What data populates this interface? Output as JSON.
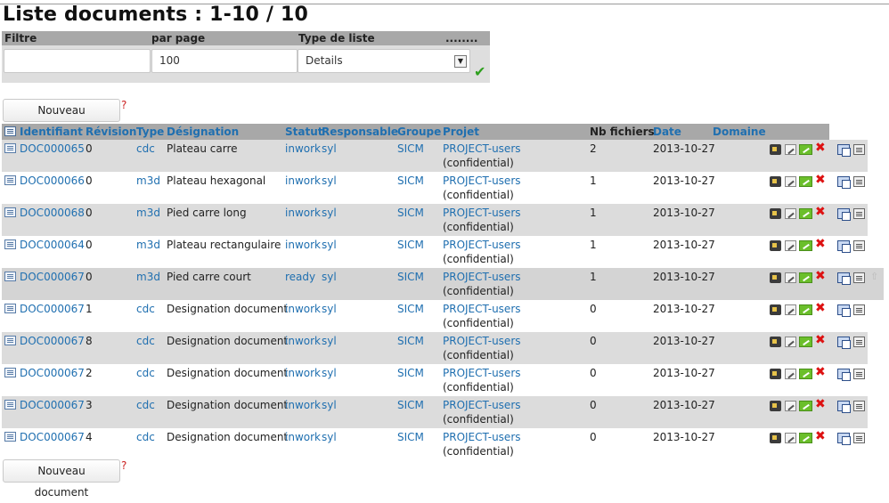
{
  "page": {
    "title": "Liste documents : 1-10 / 10"
  },
  "filters": {
    "headers": [
      "Filtre",
      "par page",
      "Type de liste",
      "........"
    ],
    "filter_value": "",
    "per_page_value": "100",
    "list_type_value": "Details",
    "apply_icon": "check-icon"
  },
  "buttons": {
    "new_document": "Nouveau document"
  },
  "table": {
    "columns": [
      "Identifiant",
      "Révision",
      "Type",
      "Désignation",
      "Statut",
      "Responsable",
      "Groupe",
      "Projet",
      "Nb fichiers",
      "Date",
      "Domaine"
    ],
    "rows": [
      {
        "id": "DOC000065",
        "rev": "0",
        "type": "cdc",
        "designation": "Plateau carre",
        "status": "inwork",
        "owner": "syl",
        "group": "SICM",
        "project": "PROJECT-users",
        "project_note": "(confidential)",
        "files": "2",
        "date": "2013-10-27",
        "domain": ""
      },
      {
        "id": "DOC000066",
        "rev": "0",
        "type": "m3d",
        "designation": "Plateau hexagonal",
        "status": "inwork",
        "owner": "syl",
        "group": "SICM",
        "project": "PROJECT-users",
        "project_note": "(confidential)",
        "files": "1",
        "date": "2013-10-27",
        "domain": ""
      },
      {
        "id": "DOC000068",
        "rev": "0",
        "type": "m3d",
        "designation": "Pied carre long",
        "status": "inwork",
        "owner": "syl",
        "group": "SICM",
        "project": "PROJECT-users",
        "project_note": "(confidential)",
        "files": "1",
        "date": "2013-10-27",
        "domain": ""
      },
      {
        "id": "DOC000064",
        "rev": "0",
        "type": "m3d",
        "designation": "Plateau rectangulaire",
        "status": "inwork",
        "owner": "syl",
        "group": "SICM",
        "project": "PROJECT-users",
        "project_note": "(confidential)",
        "files": "1",
        "date": "2013-10-27",
        "domain": ""
      },
      {
        "id": "DOC000067",
        "rev": "0",
        "type": "m3d",
        "designation": "Pied carre court",
        "status": "ready",
        "owner": "syl",
        "group": "SICM",
        "project": "PROJECT-users",
        "project_note": "(confidential)",
        "files": "1",
        "date": "2013-10-27",
        "domain": ""
      },
      {
        "id": "DOC000067",
        "rev": "1",
        "type": "cdc",
        "designation": "Designation document",
        "status": "inwork",
        "owner": "syl",
        "group": "SICM",
        "project": "PROJECT-users",
        "project_note": "(confidential)",
        "files": "0",
        "date": "2013-10-27",
        "domain": ""
      },
      {
        "id": "DOC000067",
        "rev": "8",
        "type": "cdc",
        "designation": "Designation document",
        "status": "inwork",
        "owner": "syl",
        "group": "SICM",
        "project": "PROJECT-users",
        "project_note": "(confidential)",
        "files": "0",
        "date": "2013-10-27",
        "domain": ""
      },
      {
        "id": "DOC000067",
        "rev": "2",
        "type": "cdc",
        "designation": "Designation document",
        "status": "inwork",
        "owner": "syl",
        "group": "SICM",
        "project": "PROJECT-users",
        "project_note": "(confidential)",
        "files": "0",
        "date": "2013-10-27",
        "domain": ""
      },
      {
        "id": "DOC000067",
        "rev": "3",
        "type": "cdc",
        "designation": "Designation document",
        "status": "inwork",
        "owner": "syl",
        "group": "SICM",
        "project": "PROJECT-users",
        "project_note": "(confidential)",
        "files": "0",
        "date": "2013-10-27",
        "domain": ""
      },
      {
        "id": "DOC000067",
        "rev": "4",
        "type": "cdc",
        "designation": "Designation document",
        "status": "inwork",
        "owner": "syl",
        "group": "SICM",
        "project": "PROJECT-users",
        "project_note": "(confidential)",
        "files": "0",
        "date": "2013-10-27",
        "domain": ""
      }
    ],
    "row_actions": [
      "checkout-icon",
      "edit-icon",
      "change-status-icon",
      "delete-icon",
      "copy-icon",
      "clipboard-icon"
    ],
    "hover_row_index": 4,
    "hover_extra_action": "move-up-icon"
  }
}
